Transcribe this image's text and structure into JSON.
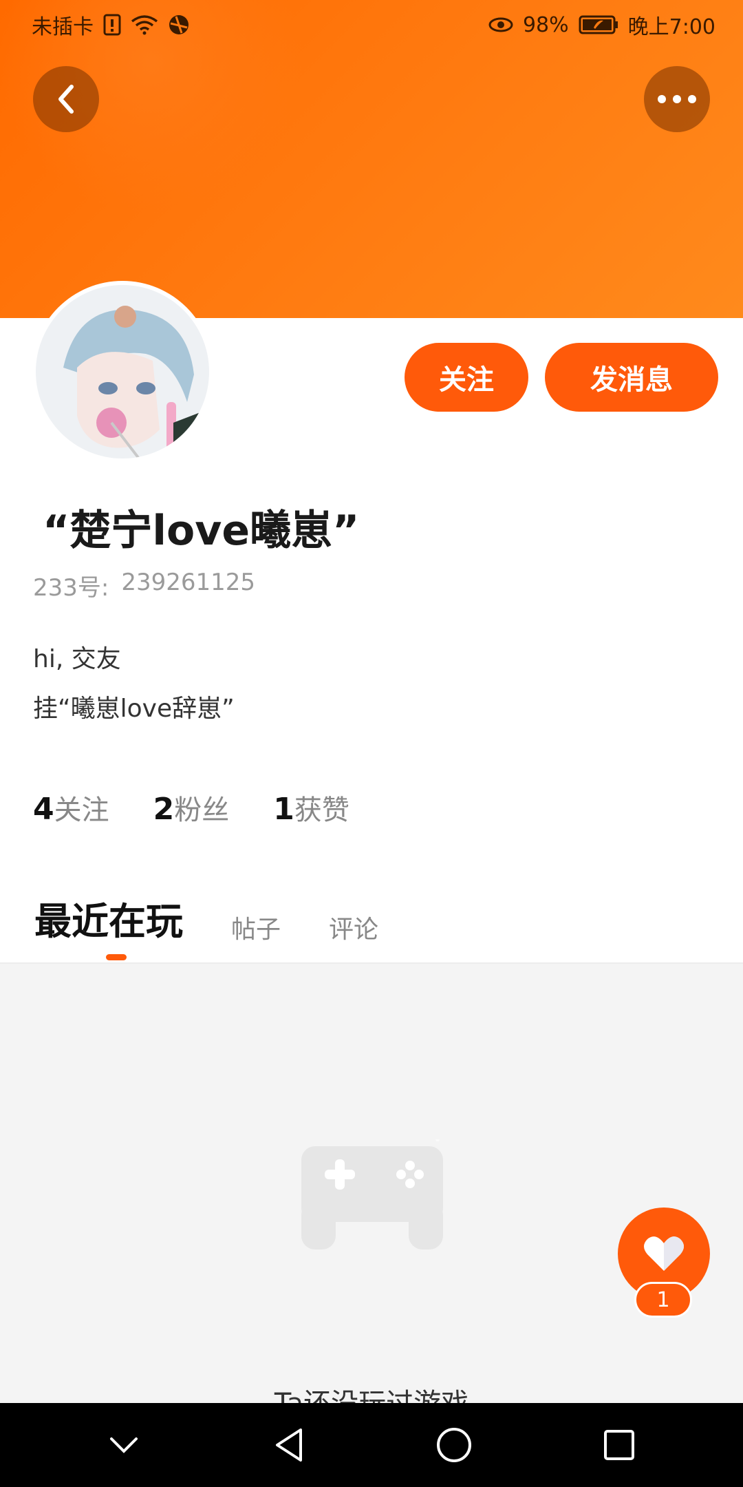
{
  "statusbar": {
    "carrier": "未插卡",
    "battery": "98%",
    "time": "晚上7:00"
  },
  "header": {
    "back_icon": "chevron-left-icon",
    "more_icon": "more-horizontal-icon"
  },
  "actions": {
    "follow_label": "关注",
    "message_label": "发消息"
  },
  "profile": {
    "username": "“楚宁love曦崽”",
    "uid_label": "233号:",
    "uid_value": "239261125",
    "bio_lines": [
      "hi, 交友",
      "挂“曦崽love辞崽”"
    ]
  },
  "stats": [
    {
      "num": "4",
      "label": "关注"
    },
    {
      "num": "2",
      "label": "粉丝"
    },
    {
      "num": "1",
      "label": "获赞"
    }
  ],
  "tabs": [
    {
      "label": "最近在玩",
      "active": true
    },
    {
      "label": "帖子",
      "active": false
    },
    {
      "label": "评论",
      "active": false
    }
  ],
  "empty": {
    "text": "Ta还没玩过游戏",
    "icon": "gamepad-icon"
  },
  "fab": {
    "icon": "heart-icon",
    "count": "1"
  },
  "colors": {
    "accent": "#ff5a0a",
    "header": "#ff7a10"
  }
}
